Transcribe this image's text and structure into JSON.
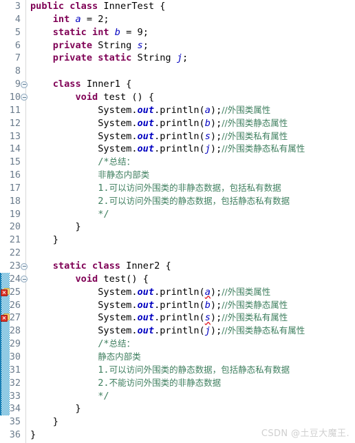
{
  "editor": {
    "app": "eclipse-java-editor",
    "language": "Java",
    "first_line_number": 3,
    "last_line_number": 36,
    "colors": {
      "background": "#ffffff",
      "keyword": "#7f0055",
      "field": "#0000c0",
      "comment": "#3f7f5f",
      "line_number": "#6a7b8c",
      "error_marker": "#d93025",
      "change_bar": "#2196c9",
      "watermark": "#cfcfcf"
    },
    "change_bar": {
      "from_line": 24,
      "to_line": 34
    }
  },
  "watermark": {
    "text": "CSDN @土豆大魔王."
  },
  "lines": [
    {
      "num": "3",
      "fold": false,
      "error": false,
      "tokens": [
        {
          "t": "public",
          "c": "kw"
        },
        {
          "t": " ",
          "c": "plain"
        },
        {
          "t": "class",
          "c": "kw"
        },
        {
          "t": " InnerTest {",
          "c": "plain"
        }
      ]
    },
    {
      "num": "4",
      "fold": false,
      "error": false,
      "tokens": [
        {
          "t": "    ",
          "c": "plain"
        },
        {
          "t": "int",
          "c": "kw"
        },
        {
          "t": " ",
          "c": "plain"
        },
        {
          "t": "a",
          "c": "fld"
        },
        {
          "t": " = 2;",
          "c": "plain"
        }
      ]
    },
    {
      "num": "5",
      "fold": false,
      "error": false,
      "tokens": [
        {
          "t": "    ",
          "c": "plain"
        },
        {
          "t": "static int",
          "c": "kw"
        },
        {
          "t": " ",
          "c": "plain"
        },
        {
          "t": "b",
          "c": "fld"
        },
        {
          "t": " = 9;",
          "c": "plain"
        }
      ]
    },
    {
      "num": "6",
      "fold": false,
      "error": false,
      "tokens": [
        {
          "t": "    ",
          "c": "plain"
        },
        {
          "t": "private",
          "c": "kw"
        },
        {
          "t": " String ",
          "c": "plain"
        },
        {
          "t": "s",
          "c": "fld"
        },
        {
          "t": ";",
          "c": "plain"
        }
      ]
    },
    {
      "num": "7",
      "fold": false,
      "error": false,
      "tokens": [
        {
          "t": "    ",
          "c": "plain"
        },
        {
          "t": "private static",
          "c": "kw"
        },
        {
          "t": " String ",
          "c": "plain"
        },
        {
          "t": "j",
          "c": "fld"
        },
        {
          "t": ";",
          "c": "plain"
        }
      ]
    },
    {
      "num": "8",
      "fold": false,
      "error": false,
      "tokens": []
    },
    {
      "num": "9",
      "fold": true,
      "error": false,
      "tokens": [
        {
          "t": "    ",
          "c": "plain"
        },
        {
          "t": "class",
          "c": "kw"
        },
        {
          "t": " Inner1 {",
          "c": "plain"
        }
      ]
    },
    {
      "num": "10",
      "fold": true,
      "error": false,
      "tokens": [
        {
          "t": "        ",
          "c": "plain"
        },
        {
          "t": "void",
          "c": "kw"
        },
        {
          "t": " test () {",
          "c": "plain"
        }
      ]
    },
    {
      "num": "11",
      "fold": false,
      "error": false,
      "tokens": [
        {
          "t": "            System.",
          "c": "plain"
        },
        {
          "t": "out",
          "c": "sfld"
        },
        {
          "t": ".println(",
          "c": "plain"
        },
        {
          "t": "a",
          "c": "fld"
        },
        {
          "t": ");",
          "c": "plain"
        },
        {
          "t": "//外围类属性",
          "c": "cmt cjk"
        }
      ]
    },
    {
      "num": "12",
      "fold": false,
      "error": false,
      "tokens": [
        {
          "t": "            System.",
          "c": "plain"
        },
        {
          "t": "out",
          "c": "sfld"
        },
        {
          "t": ".println(",
          "c": "plain"
        },
        {
          "t": "b",
          "c": "fld"
        },
        {
          "t": ");",
          "c": "plain"
        },
        {
          "t": "//外围类静态属性",
          "c": "cmt cjk"
        }
      ]
    },
    {
      "num": "13",
      "fold": false,
      "error": false,
      "tokens": [
        {
          "t": "            System.",
          "c": "plain"
        },
        {
          "t": "out",
          "c": "sfld"
        },
        {
          "t": ".println(",
          "c": "plain"
        },
        {
          "t": "s",
          "c": "fld"
        },
        {
          "t": ");",
          "c": "plain"
        },
        {
          "t": "//外围类私有属性",
          "c": "cmt cjk"
        }
      ]
    },
    {
      "num": "14",
      "fold": false,
      "error": false,
      "tokens": [
        {
          "t": "            System.",
          "c": "plain"
        },
        {
          "t": "out",
          "c": "sfld"
        },
        {
          "t": ".println(",
          "c": "plain"
        },
        {
          "t": "j",
          "c": "fld"
        },
        {
          "t": ");",
          "c": "plain"
        },
        {
          "t": "//外围类静态私有属性",
          "c": "cmt cjk"
        }
      ]
    },
    {
      "num": "15",
      "fold": false,
      "error": false,
      "tokens": [
        {
          "t": "            /*",
          "c": "cmt"
        },
        {
          "t": "总结：",
          "c": "cmt cjk"
        }
      ]
    },
    {
      "num": "16",
      "fold": false,
      "error": false,
      "tokens": [
        {
          "t": "            ",
          "c": "plain"
        },
        {
          "t": "非静态内部类",
          "c": "cmt cjk"
        }
      ]
    },
    {
      "num": "17",
      "fold": false,
      "error": false,
      "tokens": [
        {
          "t": "            ",
          "c": "plain"
        },
        {
          "t": "1.",
          "c": "cmt"
        },
        {
          "t": "可以访问外围类的非静态数据，包括私有数据",
          "c": "cmt cjk"
        }
      ]
    },
    {
      "num": "18",
      "fold": false,
      "error": false,
      "tokens": [
        {
          "t": "            ",
          "c": "plain"
        },
        {
          "t": "2.",
          "c": "cmt"
        },
        {
          "t": "可以访问外围类的静态数据，包括静态私有数据",
          "c": "cmt cjk"
        }
      ]
    },
    {
      "num": "19",
      "fold": false,
      "error": false,
      "tokens": [
        {
          "t": "            */",
          "c": "cmt"
        }
      ]
    },
    {
      "num": "20",
      "fold": false,
      "error": false,
      "tokens": [
        {
          "t": "        }",
          "c": "plain"
        }
      ]
    },
    {
      "num": "21",
      "fold": false,
      "error": false,
      "tokens": [
        {
          "t": "    }",
          "c": "plain"
        }
      ]
    },
    {
      "num": "22",
      "fold": false,
      "error": false,
      "tokens": []
    },
    {
      "num": "23",
      "fold": true,
      "error": false,
      "tokens": [
        {
          "t": "    ",
          "c": "plain"
        },
        {
          "t": "static class",
          "c": "kw"
        },
        {
          "t": " Inner2 {",
          "c": "plain"
        }
      ]
    },
    {
      "num": "24",
      "fold": true,
      "error": false,
      "tokens": [
        {
          "t": "        ",
          "c": "plain"
        },
        {
          "t": "void",
          "c": "kw"
        },
        {
          "t": " test() {",
          "c": "plain"
        }
      ]
    },
    {
      "num": "25",
      "fold": false,
      "error": true,
      "tokens": [
        {
          "t": "            System.",
          "c": "plain"
        },
        {
          "t": "out",
          "c": "sfld"
        },
        {
          "t": ".println(",
          "c": "plain"
        },
        {
          "t": "a",
          "c": "fld err"
        },
        {
          "t": ");",
          "c": "plain"
        },
        {
          "t": "//外围类属性",
          "c": "cmt cjk"
        }
      ]
    },
    {
      "num": "26",
      "fold": false,
      "error": false,
      "tokens": [
        {
          "t": "            System.",
          "c": "plain"
        },
        {
          "t": "out",
          "c": "sfld"
        },
        {
          "t": ".println(",
          "c": "plain"
        },
        {
          "t": "b",
          "c": "fld"
        },
        {
          "t": ");",
          "c": "plain"
        },
        {
          "t": "//外围类静态属性",
          "c": "cmt cjk"
        }
      ]
    },
    {
      "num": "27",
      "fold": false,
      "error": true,
      "tokens": [
        {
          "t": "            System.",
          "c": "plain"
        },
        {
          "t": "out",
          "c": "sfld"
        },
        {
          "t": ".println(",
          "c": "plain"
        },
        {
          "t": "s",
          "c": "fld err"
        },
        {
          "t": ");",
          "c": "plain"
        },
        {
          "t": "//外围类私有属性",
          "c": "cmt cjk"
        }
      ]
    },
    {
      "num": "28",
      "fold": false,
      "error": false,
      "tokens": [
        {
          "t": "            System.",
          "c": "plain"
        },
        {
          "t": "out",
          "c": "sfld"
        },
        {
          "t": ".println(",
          "c": "plain"
        },
        {
          "t": "j",
          "c": "fld"
        },
        {
          "t": ");",
          "c": "plain"
        },
        {
          "t": "//外围类静态私有属性",
          "c": "cmt cjk"
        }
      ]
    },
    {
      "num": "29",
      "fold": false,
      "error": false,
      "tokens": [
        {
          "t": "            /*",
          "c": "cmt"
        },
        {
          "t": "总结：",
          "c": "cmt cjk"
        }
      ]
    },
    {
      "num": "30",
      "fold": false,
      "error": false,
      "tokens": [
        {
          "t": "            ",
          "c": "plain"
        },
        {
          "t": "静态内部类",
          "c": "cmt cjk"
        }
      ]
    },
    {
      "num": "31",
      "fold": false,
      "error": false,
      "tokens": [
        {
          "t": "            ",
          "c": "plain"
        },
        {
          "t": "1.",
          "c": "cmt"
        },
        {
          "t": "可以访问外围类的静态数据，包括静态私有数据",
          "c": "cmt cjk"
        }
      ]
    },
    {
      "num": "32",
      "fold": false,
      "error": false,
      "tokens": [
        {
          "t": "            ",
          "c": "plain"
        },
        {
          "t": "2.",
          "c": "cmt"
        },
        {
          "t": "不能访问外围类的非静态数据",
          "c": "cmt cjk"
        }
      ]
    },
    {
      "num": "33",
      "fold": false,
      "error": false,
      "tokens": [
        {
          "t": "            */",
          "c": "cmt"
        }
      ]
    },
    {
      "num": "34",
      "fold": false,
      "error": false,
      "tokens": [
        {
          "t": "        }",
          "c": "plain"
        }
      ]
    },
    {
      "num": "35",
      "fold": false,
      "error": false,
      "tokens": [
        {
          "t": "    }",
          "c": "plain"
        }
      ]
    },
    {
      "num": "36",
      "fold": false,
      "error": false,
      "tokens": [
        {
          "t": "}",
          "c": "plain"
        }
      ]
    }
  ]
}
